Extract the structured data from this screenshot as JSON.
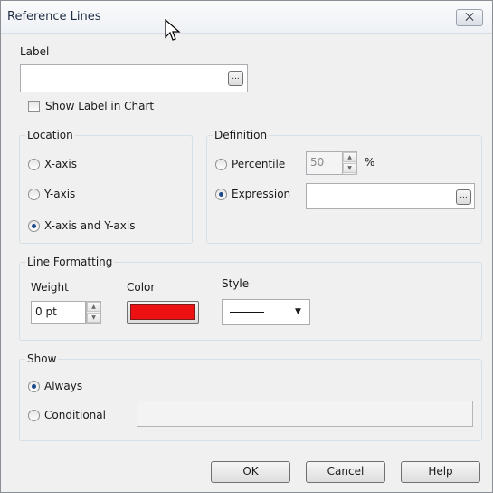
{
  "window": {
    "title": "Reference Lines",
    "close_label": "⨉"
  },
  "label_section": {
    "label": "Label",
    "value": "",
    "ellipsis": "...",
    "show_label_checkbox": "Show Label in Chart",
    "show_label_checked": false
  },
  "location": {
    "title": "Location",
    "options": [
      "X-axis",
      "Y-axis",
      "X-axis and Y-axis"
    ],
    "selected": "X-axis and Y-axis"
  },
  "definition": {
    "title": "Definition",
    "percentile_label": "Percentile",
    "percentile_value": "50",
    "percent_sign": "%",
    "expression_label": "Expression",
    "expression_value": "",
    "ellipsis": "...",
    "selected": "Expression"
  },
  "line_formatting": {
    "title": "Line Formatting",
    "weight_label": "Weight",
    "weight_value": "0 pt",
    "color_label": "Color",
    "color_value": "#ee1111",
    "style_label": "Style",
    "style_value": "solid"
  },
  "show": {
    "title": "Show",
    "always_label": "Always",
    "conditional_label": "Conditional",
    "conditional_value": "",
    "selected": "Always"
  },
  "buttons": {
    "ok": "OK",
    "cancel": "Cancel",
    "help": "Help"
  },
  "colors": {
    "accent_radio": "#1c4a8a",
    "swatch": "#ee1111"
  }
}
